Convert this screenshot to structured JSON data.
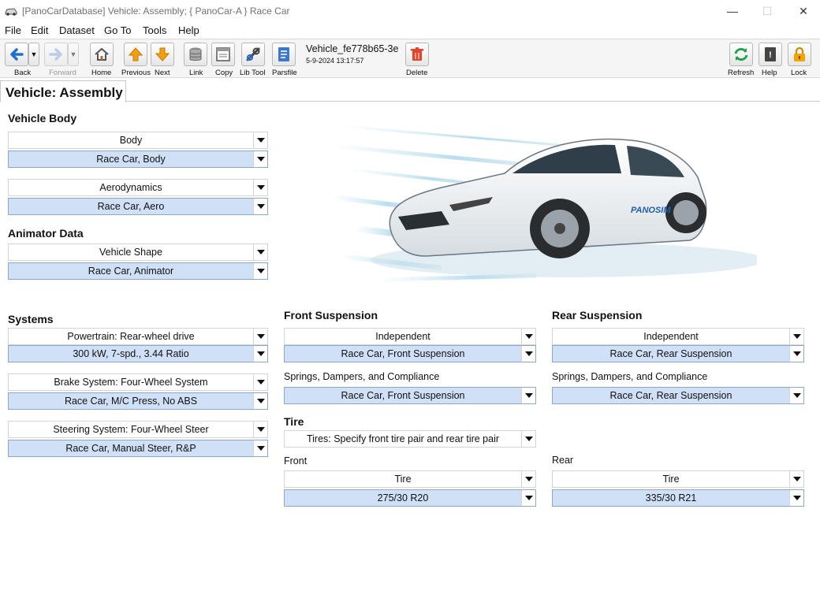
{
  "window": {
    "title": "[PanoCarDatabase] Vehicle: Assembly; { PanoCar-A } Race Car",
    "minimize": "—",
    "maximize": "☐",
    "close": "✕"
  },
  "menu": [
    "File",
    "Edit",
    "Dataset",
    "Go To",
    "Tools",
    "Help"
  ],
  "toolbar": {
    "back": "Back",
    "forward": "Forward",
    "home": "Home",
    "previous": "Previous",
    "next": "Next",
    "link": "Link",
    "copy": "Copy",
    "lib_tool": "Lib Tool",
    "parsfile": "Parsfile",
    "vehicle_name": "Vehicle_fe778b65-3e",
    "vehicle_date": "5-9-2024 13:17:57",
    "delete": "Delete",
    "refresh": "Refresh",
    "help": "Help",
    "lock": "Lock"
  },
  "tab": {
    "label": "Vehicle: Assembly"
  },
  "vehicle_body": {
    "title": "Vehicle Body",
    "body_type": "Body",
    "body_value": "Race Car, Body",
    "aero_type": "Aerodynamics",
    "aero_value": "Race Car, Aero"
  },
  "animator": {
    "title": "Animator Data",
    "shape_type": "Vehicle Shape",
    "shape_value": "Race Car, Animator"
  },
  "systems": {
    "title": "Systems",
    "powertrain_type": "Powertrain: Rear-wheel drive",
    "powertrain_value": "300 kW, 7-spd., 3.44 Ratio",
    "brake_type": "Brake System: Four-Wheel System",
    "brake_value": "Race Car, M/C Press, No ABS",
    "steering_type": "Steering System: Four-Wheel Steer",
    "steering_value": "Race Car, Manual Steer, R&P"
  },
  "front_suspension": {
    "title": "Front Suspension",
    "kin_type": "Independent",
    "kin_value": "Race Car, Front Suspension",
    "compliance_label": "Springs, Dampers, and Compliance",
    "compliance_value": "Race Car, Front Suspension"
  },
  "rear_suspension": {
    "title": "Rear Suspension",
    "kin_type": "Independent",
    "kin_value": "Race Car, Rear Suspension",
    "compliance_label": "Springs, Dampers, and Compliance",
    "compliance_value": "Race Car, Rear Suspension"
  },
  "tire": {
    "title": "Tire",
    "mode": "Tires: Specify front tire pair and rear tire pair",
    "front_label": "Front",
    "front_type": "Tire",
    "front_value": "275/30 R20",
    "rear_label": "Rear",
    "rear_type": "Tire",
    "rear_value": "335/30 R21"
  },
  "car_image": {
    "logo_text": "PANOSIM"
  }
}
